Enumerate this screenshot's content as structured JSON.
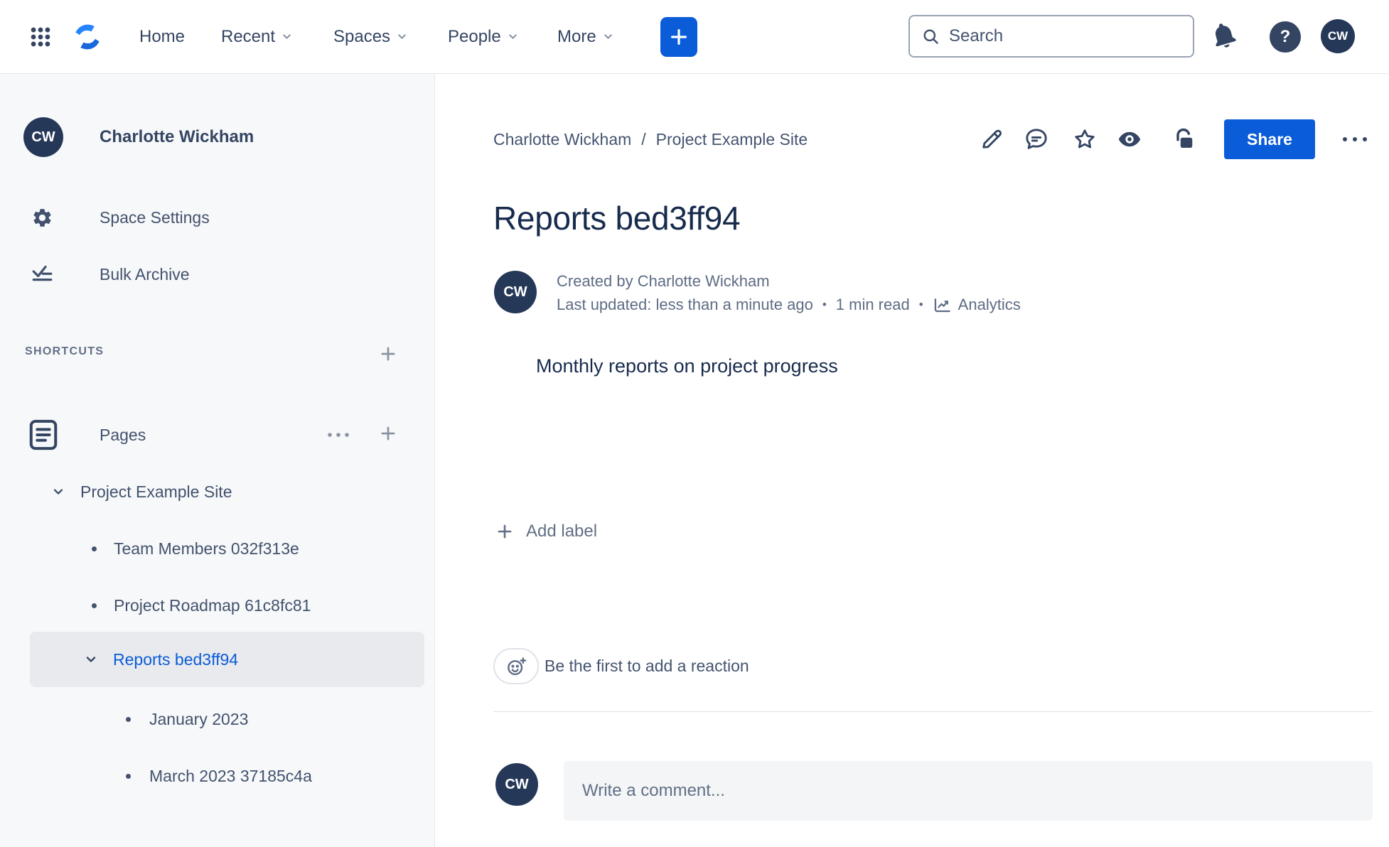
{
  "colors": {
    "brand_blue": "#0B5CD8",
    "avatar_navy": "#253858",
    "icon_navy": "#344563",
    "text_dark": "#172B4D",
    "text_gray": "#626F86",
    "sidebar_bg": "#F7F8F9",
    "selected_row_bg": "#E9EAED"
  },
  "topnav": {
    "nav_items": [
      {
        "label": "Home"
      },
      {
        "label": "Recent"
      },
      {
        "label": "Spaces"
      },
      {
        "label": "People"
      },
      {
        "label": "More"
      }
    ],
    "search_placeholder": "Search",
    "help_glyph": "?",
    "profile_initials": "CW",
    "icons": [
      "app-switcher-grid",
      "confluence-logo",
      "plus",
      "search-magnifier",
      "notification-bell",
      "help-question",
      "avatar"
    ]
  },
  "sidebar": {
    "space_avatar_initials": "CW",
    "space_name": "Charlotte Wickham",
    "menu_items": [
      {
        "label": "Space Settings",
        "icon": "gear-icon"
      },
      {
        "label": "Bulk Archive",
        "icon": "bulk-archive-icon"
      }
    ],
    "shortcuts_header": "SHORTCUTS",
    "content_tree_header": "Pages",
    "tree_items": [
      {
        "label": "Project Example Site",
        "level": 0,
        "expanded": true,
        "selected": false
      },
      {
        "label": "Team Members 032f313e",
        "level": 1,
        "selected": false
      },
      {
        "label": "Project Roadmap 61c8fc81",
        "level": 1,
        "selected": false
      },
      {
        "label": "Reports bed3ff94",
        "level": 1,
        "expanded": true,
        "selected": true
      },
      {
        "label": "January 2023",
        "level": 2,
        "selected": false
      },
      {
        "label": "March 2023 37185c4a",
        "level": 2,
        "selected": false
      }
    ]
  },
  "content": {
    "breadcrumb": {
      "items": [
        {
          "label": "Charlotte Wickham"
        },
        {
          "label": "Project Example Site"
        }
      ],
      "separator": "/"
    },
    "page_title": "Reports bed3ff94",
    "share_button": "Share",
    "byline": {
      "avatar_initials": "CW",
      "created_by": "Created by Charlotte Wickham",
      "last_updated": "Last updated: less than a minute ago",
      "read_time": "1 min read",
      "analytics_label": "Analytics",
      "separator": "•"
    },
    "body_paragraph": "Monthly reports on project progress",
    "add_label_button": "Add label",
    "reactions_prompt": "Be the first to add a reaction",
    "comment": {
      "avatar_initials": "CW",
      "placeholder": "Write a comment..."
    }
  }
}
